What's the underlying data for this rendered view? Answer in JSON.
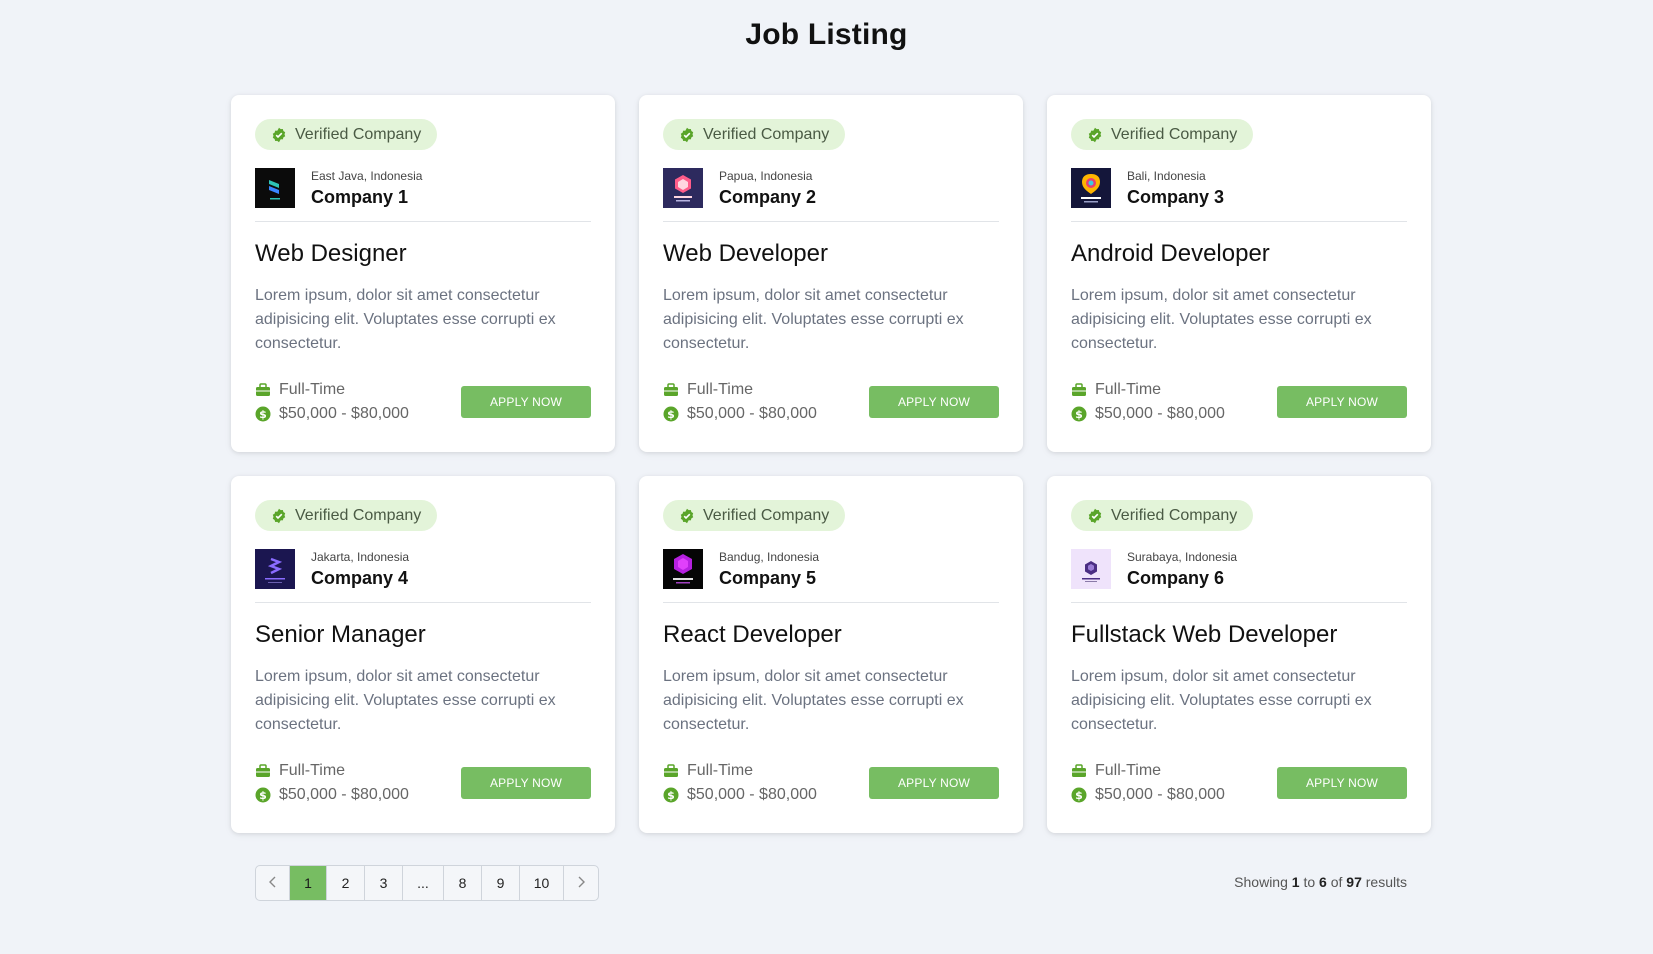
{
  "page": {
    "title": "Job Listing"
  },
  "colors": {
    "accent": "#77bd62",
    "badge_bg": "#e3f4d9",
    "icon_green": "#5aa52a",
    "background": "#f0f3f8"
  },
  "jobs": [
    {
      "badge": "Verified Company",
      "location": "East Java, Indonesia",
      "company": "Company 1",
      "title": "Web Designer",
      "description": "Lorem ipsum, dolor sit amet consectetur adipisicing elit. Voluptates esse corrupti ex consectetur.",
      "type": "Full-Time",
      "salary": "$50,000 - $80,000",
      "apply_label": "APPLY NOW"
    },
    {
      "badge": "Verified Company",
      "location": "Papua, Indonesia",
      "company": "Company 2",
      "title": "Web Developer",
      "description": "Lorem ipsum, dolor sit amet consectetur adipisicing elit. Voluptates esse corrupti ex consectetur.",
      "type": "Full-Time",
      "salary": "$50,000 - $80,000",
      "apply_label": "APPLY NOW"
    },
    {
      "badge": "Verified Company",
      "location": "Bali, Indonesia",
      "company": "Company 3",
      "title": "Android Developer",
      "description": "Lorem ipsum, dolor sit amet consectetur adipisicing elit. Voluptates esse corrupti ex consectetur.",
      "type": "Full-Time",
      "salary": "$50,000 - $80,000",
      "apply_label": "APPLY NOW"
    },
    {
      "badge": "Verified Company",
      "location": "Jakarta, Indonesia",
      "company": "Company 4",
      "title": "Senior Manager",
      "description": "Lorem ipsum, dolor sit amet consectetur adipisicing elit. Voluptates esse corrupti ex consectetur.",
      "type": "Full-Time",
      "salary": "$50,000 - $80,000",
      "apply_label": "APPLY NOW"
    },
    {
      "badge": "Verified Company",
      "location": "Bandug, Indonesia",
      "company": "Company 5",
      "title": "React Developer",
      "description": "Lorem ipsum, dolor sit amet consectetur adipisicing elit. Voluptates esse corrupti ex consectetur.",
      "type": "Full-Time",
      "salary": "$50,000 - $80,000",
      "apply_label": "APPLY NOW"
    },
    {
      "badge": "Verified Company",
      "location": "Surabaya, Indonesia",
      "company": "Company 6",
      "title": "Fullstack Web Developer",
      "description": "Lorem ipsum, dolor sit amet consectetur adipisicing elit. Voluptates esse corrupti ex consectetur.",
      "type": "Full-Time",
      "salary": "$50,000 - $80,000",
      "apply_label": "APPLY NOW"
    }
  ],
  "pagination": {
    "prev_icon": "chevron-left-icon",
    "next_icon": "chevron-right-icon",
    "pages": [
      "1",
      "2",
      "3",
      "...",
      "8",
      "9",
      "10"
    ],
    "current": "1"
  },
  "results": {
    "prefix": "Showing",
    "from": "1",
    "to_word": "to",
    "to": "6",
    "of_word": "of",
    "total": "97",
    "suffix": "results"
  }
}
